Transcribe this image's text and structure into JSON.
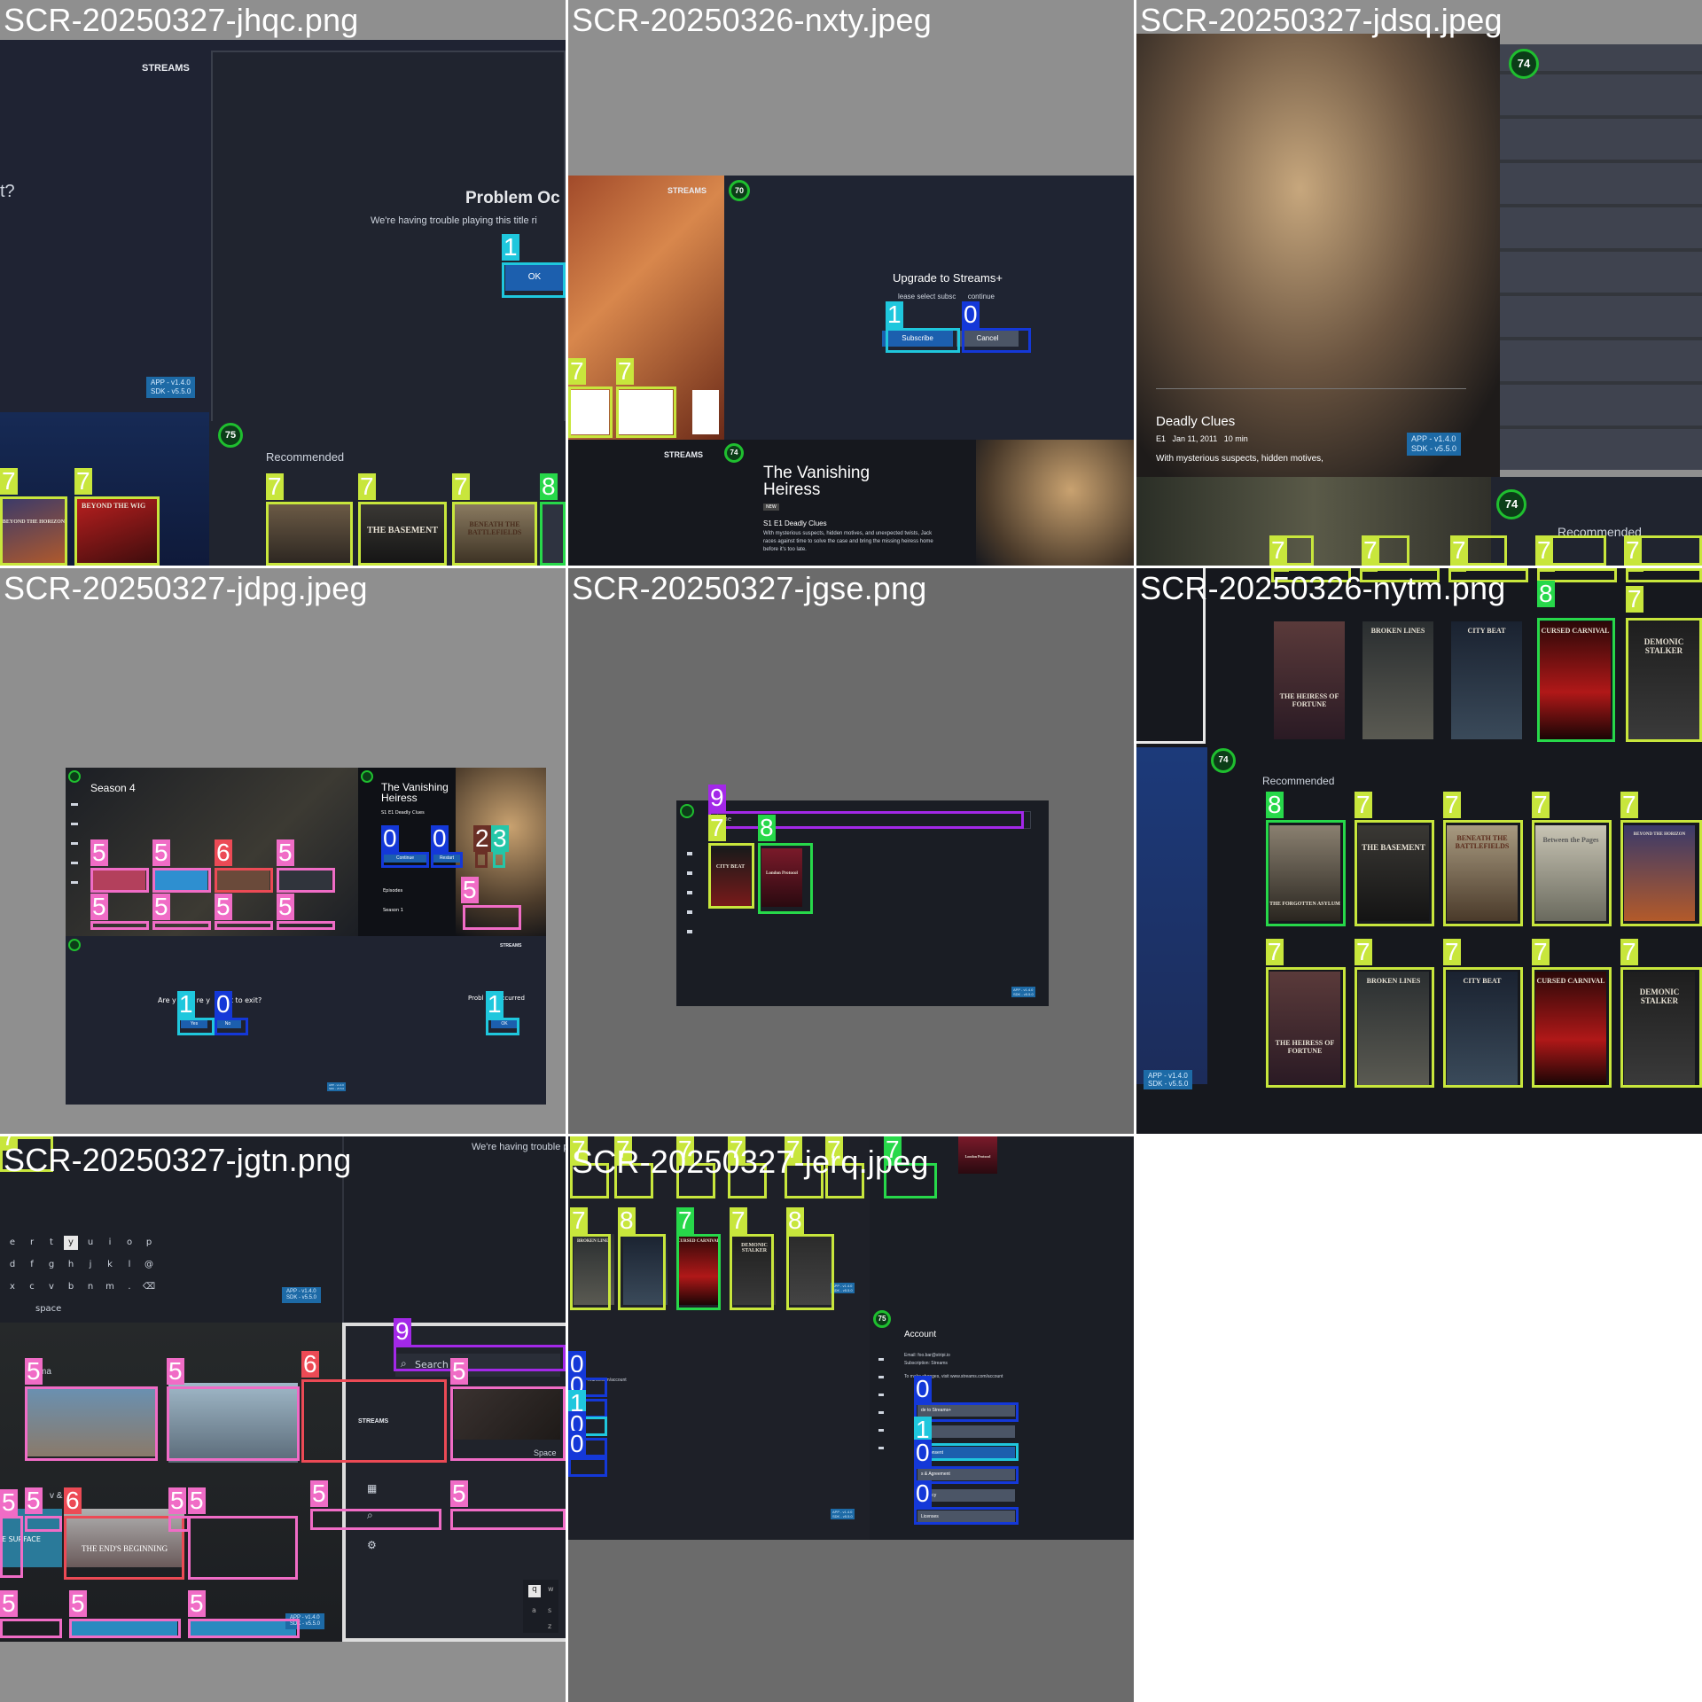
{
  "tiles": [
    {
      "name": "SCR-20250327-jhqc.png"
    },
    {
      "name": "SCR-20250326-nxty.jpeg"
    },
    {
      "name": "SCR-20250327-jdsq.jpeg"
    },
    {
      "name": "SCR-20250327-jdpg.jpeg"
    },
    {
      "name": "SCR-20250327-jgse.png"
    },
    {
      "name": "SCR-20250326-nytm.png"
    },
    {
      "name": "SCR-20250327-jgtn.png"
    },
    {
      "name": "SCR-20250327-jerq.jpeg"
    }
  ],
  "app": {
    "brand": "STREAMS",
    "version_app": "APP - v1.4.0",
    "version_sdk": "SDK - v5.5.0"
  },
  "jhqc": {
    "partial_left": "t?",
    "title": "Problem Oc",
    "message": "We're having trouble playing this title ri",
    "ok": "OK",
    "recommended": "Recommended",
    "fps": "75",
    "posters": [
      "BEYOND THE HORIZON",
      "BEYOND THE WIG",
      "THE BASEMENT",
      "BENEATH THE BATTLEFIELDS"
    ],
    "labels": [
      "7",
      "7",
      "7",
      "7",
      "7",
      "8",
      "1"
    ]
  },
  "nxty": {
    "title": "Upgrade to Streams+",
    "subtitle": "lease select subsc",
    "subtitle_end": "continue",
    "subscribe": "Subscribe",
    "cancel": "Cancel",
    "fps": "70",
    "fps2": "74",
    "show_title": "The Vanishing Heiress",
    "episode": "S1 E1 Deadly Clues",
    "description": "With mysterious suspects, hidden motives, and unexpected twists, Jack races against time to solve the case and bring the missing heiress home before it's too late.",
    "badge": "NEW",
    "labels": [
      "1",
      "0",
      "7",
      "7"
    ]
  },
  "jdsq": {
    "episode_title": "Deadly Clues",
    "meta": "E1   Jan 11, 2011   10 min",
    "description": "With mysterious suspects, hidden motives,",
    "fps": "74",
    "fps2": "74",
    "recommended": "Recommended",
    "labels": [
      "7",
      "7",
      "7",
      "7",
      "7"
    ]
  },
  "jdpg": {
    "season": "Season 4",
    "show_title": "The Vanishing Heiress",
    "episode": "S1 E1 Deadly Clues",
    "continue": "Continue",
    "restart": "Restart",
    "episodes": "Episodes",
    "season_item": "Season 1",
    "exit_prompt": "Are y         re y         t to exit?",
    "yes": "Yes",
    "no": "No",
    "problem": "Probl         ccurred",
    "ok": "OK",
    "labels": [
      "5",
      "5",
      "6",
      "5",
      "5",
      "5",
      "5",
      "5",
      "0",
      "0",
      "2",
      "3",
      "5",
      "1",
      "0",
      "1"
    ]
  },
  "jgse": {
    "search_placeholder": "me",
    "poster1": "CITY BEAT",
    "poster2": "London Protocol",
    "labels": [
      "9",
      "7",
      "8"
    ]
  },
  "nytm": {
    "recommended": "Recommended",
    "fps": "74",
    "posters_top": [
      "THE HEIRESS OF FORTUNE",
      "BROKEN LINES",
      "CITY BEAT",
      "CURSED CARNIVAL",
      "DEMONIC STALKER"
    ],
    "posters_mid": [
      "THE FORGOTTEN ASYLUM",
      "THE BASEMENT",
      "BENEATH THE BATTLEFIELDS",
      "Between the Pages",
      "BEYOND THE HORIZON"
    ],
    "posters_bottom": [
      "THE HEIRESS OF FORTUNE",
      "BROKEN LINES",
      "CITY BEAT",
      "CURSED CARNIVAL",
      "DEMONIC STALKER"
    ],
    "labels": [
      "7",
      "7",
      "7",
      "7",
      "7",
      "8",
      "7",
      "8",
      "7",
      "7",
      "7",
      "7",
      "7",
      "7",
      "7",
      "7",
      "7"
    ]
  },
  "jgtn": {
    "banner_text": "We're having trouble p",
    "keys_row1": [
      "e",
      "r",
      "t",
      "y",
      "u",
      "i",
      "o",
      "p"
    ],
    "keys_row2": [
      "d",
      "f",
      "g",
      "h",
      "j",
      "k",
      "l",
      "@"
    ],
    "keys_row3": [
      "x",
      "c",
      "v",
      "b",
      "n",
      "m",
      ".",
      "⌫"
    ],
    "space": "space",
    "search": "Search",
    "row_left": "ma",
    "row_left2": "v & ular",
    "surface": "E SURFACE",
    "ends_beginning": "THE END'S BEGINNING",
    "space_label": "Space",
    "kb_keys": [
      "q",
      "w",
      "a",
      "s",
      "z"
    ],
    "labels": [
      "7",
      "9",
      "5",
      "5",
      "6",
      "5",
      "5",
      "5",
      "6",
      "5",
      "5",
      "5",
      "5",
      "5",
      "5",
      "5"
    ]
  },
  "jerq": {
    "account": "Account",
    "email_line": "Email: foo.bar@stripi.io",
    "subscription": "Subscription: Streams",
    "change_note": "To make changes, visit www.streams.com/account",
    "left_url": "reams.com/account",
    "menu": [
      "de to Streams+",
      "ort",
      "cy Consent",
      "s & Agreement",
      "y Policy",
      "Licenses"
    ],
    "fps": "75",
    "posters": [
      "BROKEN LINES",
      "CURSED CARNIVAL",
      "DEMONIC STALKER",
      "London Protocol"
    ],
    "labels": [
      "7",
      "7",
      "7",
      "7",
      "7",
      "7",
      "8",
      "7",
      "7",
      "8",
      "7",
      "7",
      "0",
      "0",
      "1",
      "0",
      "0",
      "0",
      "1",
      "0",
      "0"
    ]
  },
  "colors": {
    "label_7": "#c8e63c",
    "label_8": "#27d84a",
    "label_5": "#f06cc6",
    "label_6": "#ec4a55",
    "label_1": "#1fc7dd",
    "label_0": "#1438d8",
    "label_9": "#a328e8"
  }
}
